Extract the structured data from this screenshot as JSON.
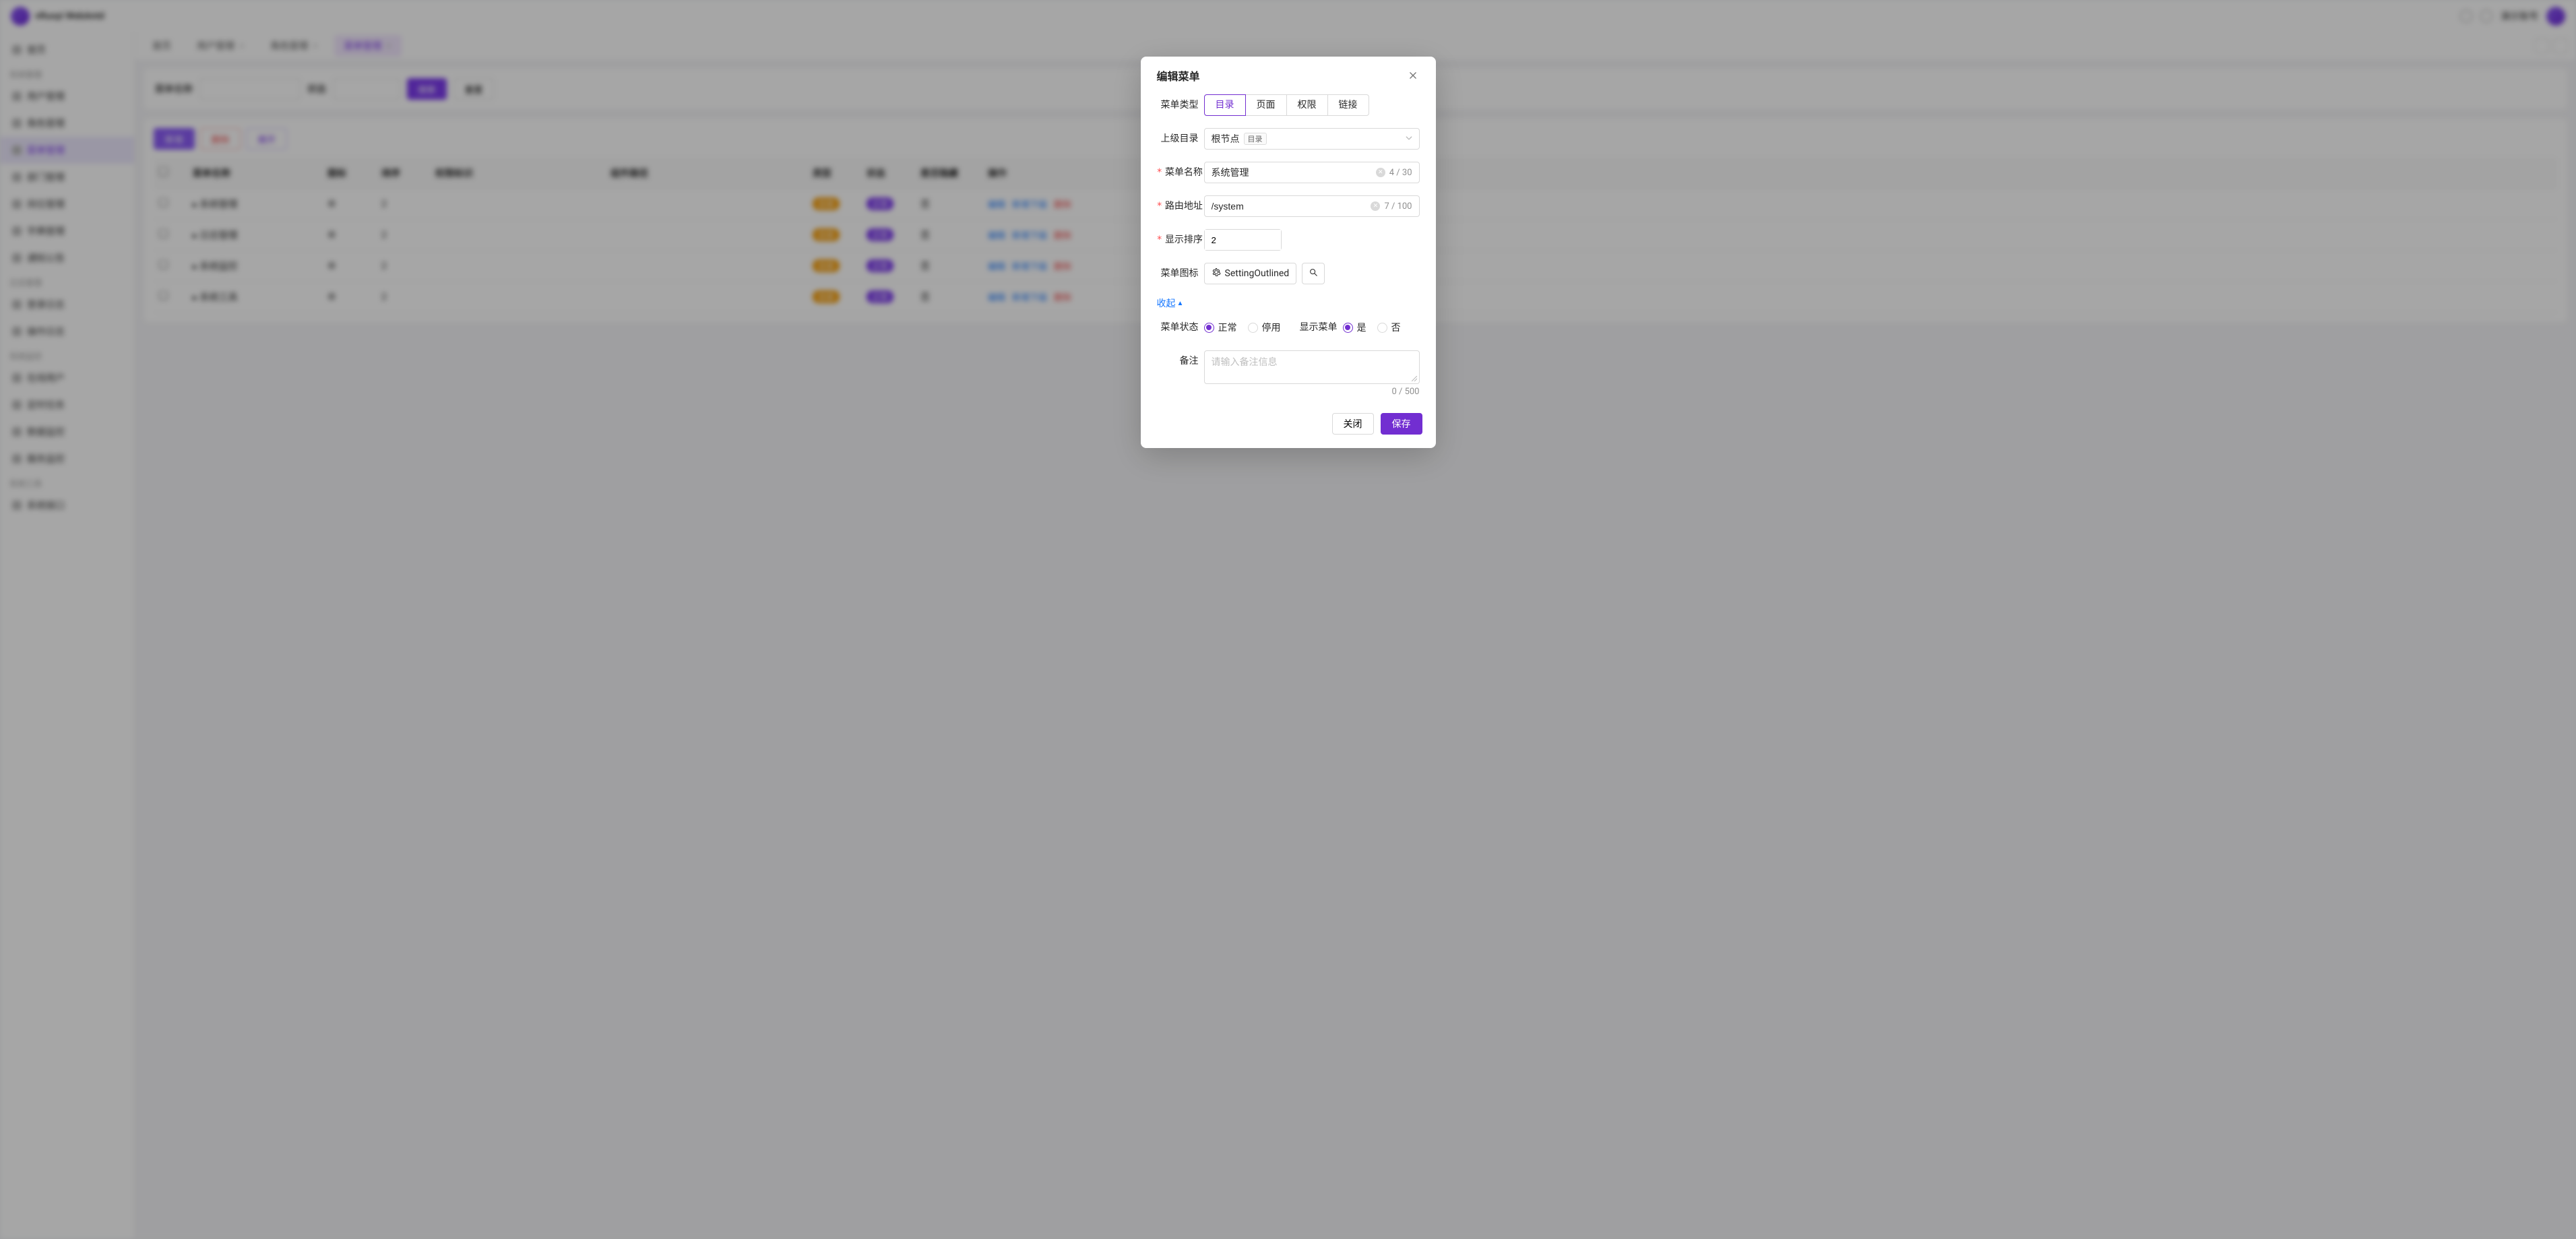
{
  "app": {
    "brand": "vRuoyi WebAntd",
    "user_label": "演示账号"
  },
  "sidebar": {
    "items": [
      {
        "label": "首页",
        "type": "item"
      },
      {
        "label": "系统管理",
        "type": "group"
      },
      {
        "label": "用户管理",
        "type": "item"
      },
      {
        "label": "角色管理",
        "type": "item"
      },
      {
        "label": "菜单管理",
        "type": "item",
        "active": true
      },
      {
        "label": "部门管理",
        "type": "item"
      },
      {
        "label": "岗位管理",
        "type": "item"
      },
      {
        "label": "字典管理",
        "type": "item"
      },
      {
        "label": "通知公告",
        "type": "item"
      },
      {
        "label": "日志管理",
        "type": "group"
      },
      {
        "label": "登录日志",
        "type": "item"
      },
      {
        "label": "操作日志",
        "type": "item"
      },
      {
        "label": "系统监控",
        "type": "group"
      },
      {
        "label": "在线用户",
        "type": "item"
      },
      {
        "label": "定时任务",
        "type": "item"
      },
      {
        "label": "数据监控",
        "type": "item"
      },
      {
        "label": "服务监控",
        "type": "item"
      },
      {
        "label": "系统工具",
        "type": "group"
      },
      {
        "label": "系统接口",
        "type": "item"
      }
    ]
  },
  "tabs": {
    "items": [
      {
        "label": "首页",
        "closable": false
      },
      {
        "label": "用户管理",
        "closable": true
      },
      {
        "label": "角色管理",
        "closable": true
      },
      {
        "label": "菜单管理",
        "closable": true,
        "active": true
      }
    ]
  },
  "search": {
    "name_label": "菜单名称",
    "name_placeholder": "请输入菜单名称",
    "status_label": "状态",
    "status_placeholder": "菜单状态",
    "submit": "搜索",
    "reset": "重置"
  },
  "toolbar_tbl": {
    "add": "新增",
    "del": "删除",
    "expand": "展开"
  },
  "table": {
    "headers": [
      "",
      "菜单名称",
      "图标",
      "排序",
      "权限标识",
      "组件路径",
      "类型",
      "状态",
      "是否隐藏",
      "操作"
    ],
    "rows": [
      {
        "name": "系统管理",
        "sort": "2",
        "type": "目录",
        "status": "正常",
        "hidden": "否"
      },
      {
        "name": "日志管理",
        "sort": "2",
        "type": "目录",
        "status": "正常",
        "hidden": "否"
      },
      {
        "name": "系统监控",
        "sort": "2",
        "type": "目录",
        "status": "正常",
        "hidden": "否"
      },
      {
        "name": "系统工具",
        "sort": "2",
        "type": "目录",
        "status": "正常",
        "hidden": "否"
      }
    ],
    "actions": {
      "edit": "编辑",
      "addsub": "新增下级",
      "del": "删除"
    }
  },
  "modal": {
    "title": "编辑菜单",
    "close_btn": "关闭",
    "save_btn": "保存",
    "labels": {
      "menu_type": "菜单类型",
      "parent": "上级目录",
      "name": "菜单名称",
      "route": "路由地址",
      "sort": "显示排序",
      "icon": "菜单图标",
      "collapse": "收起",
      "status": "菜单状态",
      "show": "显示菜单",
      "remark": "备注"
    },
    "menu_type_options": [
      "目录",
      "页面",
      "权限",
      "链接"
    ],
    "menu_type_value": "目录",
    "parent_value": "根节点",
    "parent_tag": "目录",
    "name_value": "系统管理",
    "name_counter": "4 / 30",
    "route_value": "/system",
    "route_counter": "7 / 100",
    "sort_value": "2",
    "icon_value": "SettingOutlined",
    "status_options": [
      "正常",
      "停用"
    ],
    "status_value": "正常",
    "show_options": [
      "是",
      "否"
    ],
    "show_value": "是",
    "remark_placeholder": "请输入备注信息",
    "remark_counter": "0 / 500"
  }
}
